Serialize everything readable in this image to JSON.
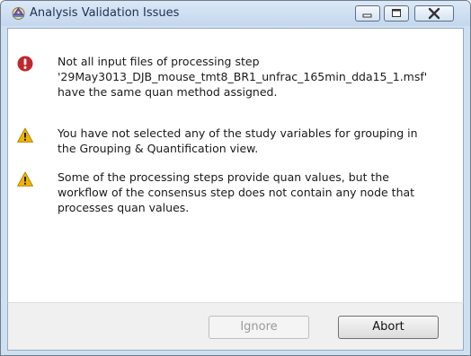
{
  "window": {
    "title": "Analysis Validation Issues",
    "icon": "wizard-hat-icon",
    "controls": [
      "minimize-icon",
      "maximize-icon",
      "close-icon"
    ]
  },
  "issues": [
    {
      "severity": "error",
      "icon": "error-icon",
      "color": "#c0282d",
      "text": "Not all input files of processing step\n'29May3013_DJB_mouse_tmt8_BR1_unfrac_165min_dda15_1.msf'\nhave the same quan method assigned."
    },
    {
      "severity": "warning",
      "icon": "warning-icon",
      "color": "#f0b400",
      "text": "You have not selected any of the study variables for grouping in\nthe Grouping & Quantification view."
    },
    {
      "severity": "warning",
      "icon": "warning-icon",
      "color": "#f0b400",
      "text": "Some of the processing steps provide quan values, but the\nworkflow of the consensus step does not contain any node that\nprocesses quan values."
    }
  ],
  "buttons": {
    "ignore_label": "Ignore",
    "ignore_enabled": false,
    "abort_label": "Abort"
  }
}
